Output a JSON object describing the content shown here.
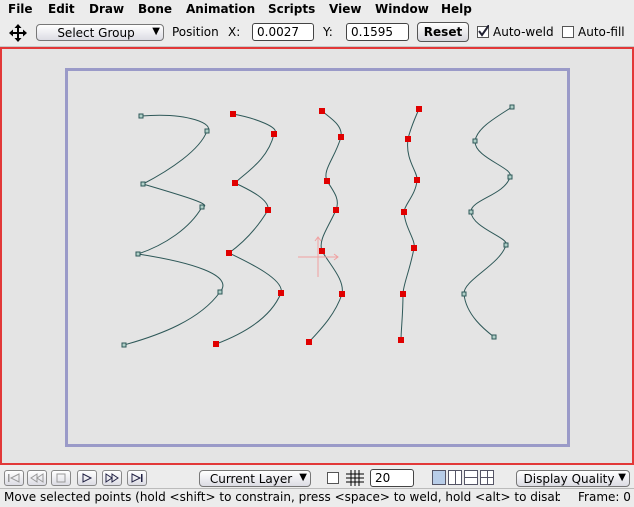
{
  "menubar": {
    "items": [
      "File",
      "Edit",
      "Draw",
      "Bone",
      "Animation",
      "Scripts",
      "View",
      "Window",
      "Help"
    ]
  },
  "toolbar": {
    "tool_icon": "move-arrows-icon",
    "group_select": "Select Group",
    "position_label": "Position",
    "x_label": "X:",
    "x_value": "0.0027",
    "y_label": "Y:",
    "y_value": "0.1595",
    "reset_label": "Reset",
    "auto_weld_label": "Auto-weld",
    "auto_weld_checked": true,
    "auto_fill_label": "Auto-fill",
    "auto_fill_checked": false
  },
  "canvas": {
    "frame_color": "#e23838",
    "bounds_color": "#9a9ac8",
    "curve_color": "#2e5858",
    "selected_point_color": "#e00000",
    "unselected_point_color": "#b0d0c8",
    "origin_marker_color": "#f0a0a0"
  },
  "bottombar": {
    "layer_select": "Current Layer",
    "grid_checked": false,
    "grid_size": "20",
    "quality_select": "Display Quality"
  },
  "statusbar": {
    "message": "Move selected points (hold <shift> to constrain, press <space> to weld, hold <alt> to disable aut",
    "frame_label": "Frame: 0"
  }
}
